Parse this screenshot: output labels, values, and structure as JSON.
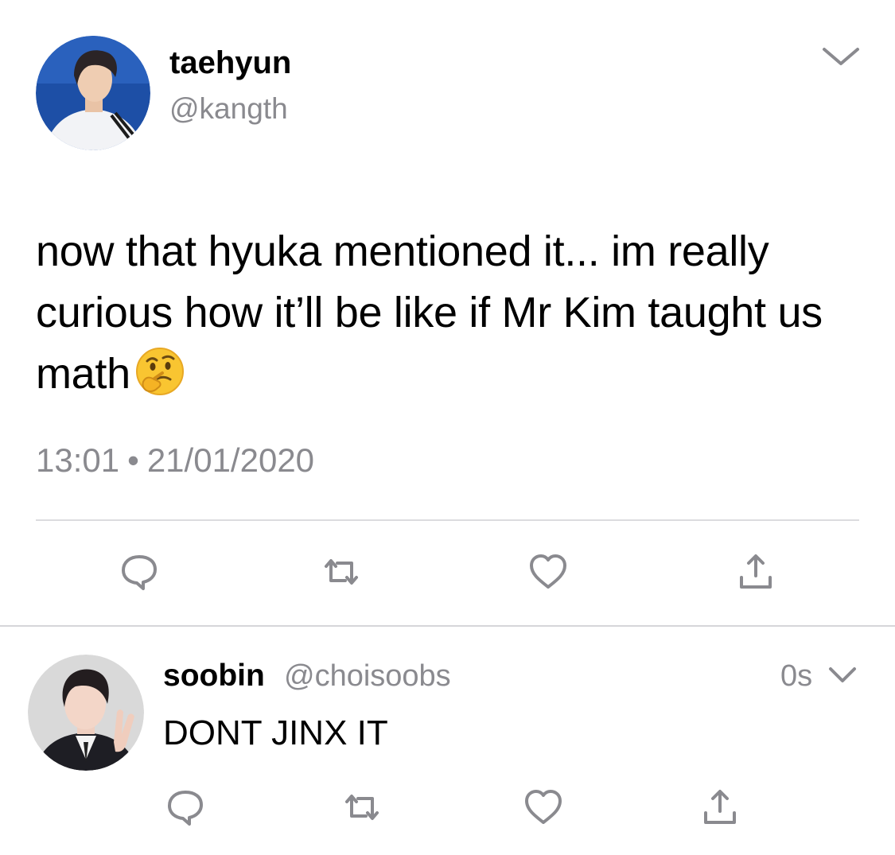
{
  "main_tweet": {
    "author_name": "taehyun",
    "author_handle": "@kangth",
    "text": "now that hyuka mentioned it... im really curious how it’ll be like if Mr Kim taught us math",
    "emoji": "thinking-face",
    "time": "13:01",
    "separator": "•",
    "date": "21/01/2020",
    "actions": [
      "reply-icon",
      "retweet-icon",
      "like-icon",
      "share-icon"
    ]
  },
  "reply_tweet": {
    "author_name": "soobin",
    "author_handle": "@choisoobs",
    "relative_time": "0s",
    "text": "DONT JINX IT",
    "actions": [
      "reply-icon",
      "retweet-icon",
      "like-icon",
      "share-icon"
    ]
  },
  "colors": {
    "text_primary": "#000000",
    "text_secondary": "#8a8a8f",
    "icon_gray": "#8a8a8f",
    "divider": "#dcdcdf"
  }
}
